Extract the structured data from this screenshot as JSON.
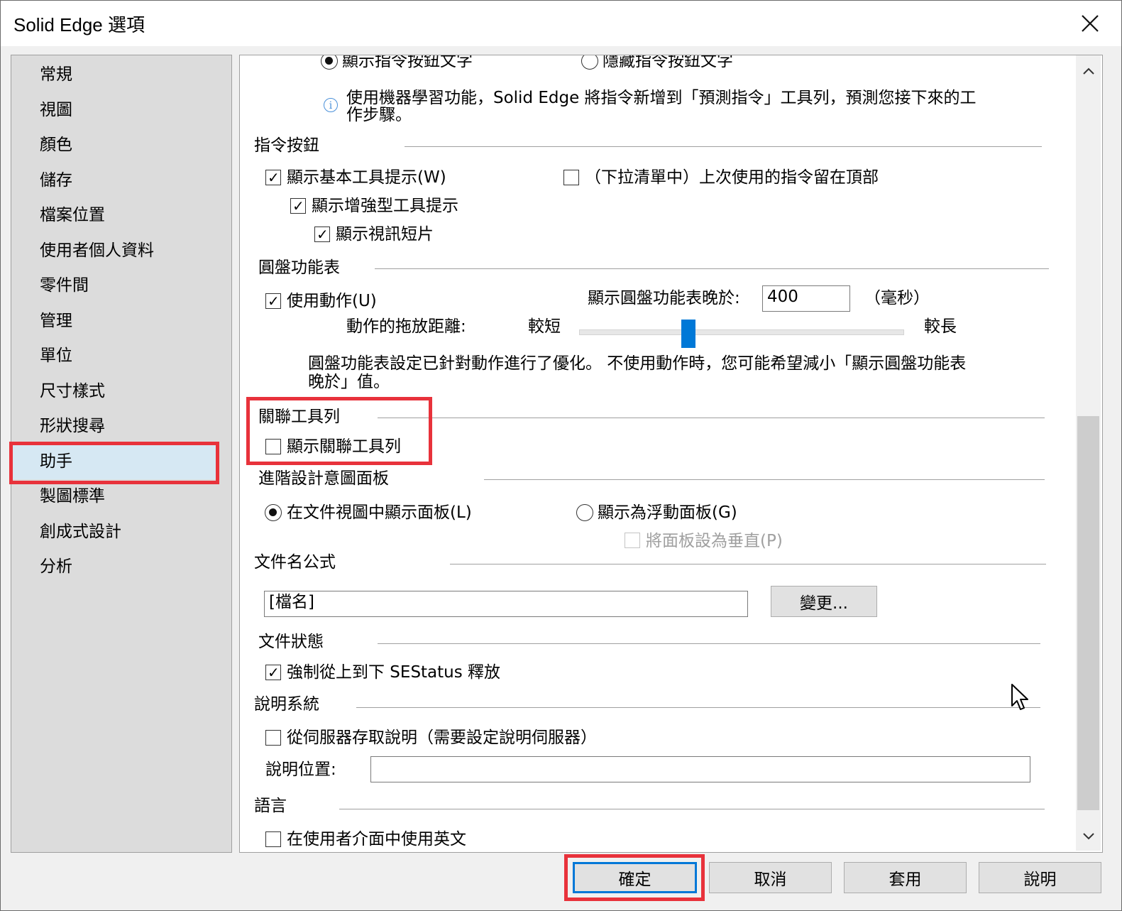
{
  "window": {
    "title": "Solid Edge 選項"
  },
  "nav": {
    "items": [
      "常規",
      "視圖",
      "顏色",
      "儲存",
      "檔案位置",
      "使用者個人資料",
      "零件間",
      "管理",
      "單位",
      "尺寸樣式",
      "形狀搜尋",
      "助手",
      "製圖標準",
      "創成式設計",
      "分析"
    ],
    "selected": "助手"
  },
  "top": {
    "show_text_radio": "顯示指令按鈕文字",
    "hide_text_radio": "隱藏指令按鈕文字",
    "info_line1": "使用機器學習功能，Solid Edge 將指令新增到「預測指令」工具列，預測您接下來的工",
    "info_line2": "作步驟。"
  },
  "command_buttons": {
    "header": "指令按鈕",
    "show_basic_tooltips": "顯示基本工具提示(W)",
    "keep_last_used_top": "（下拉清單中）上次使用的指令留在頂部",
    "show_enhanced_tooltips": "顯示增強型工具提示",
    "show_video_clips": "顯示視訊短片"
  },
  "radial_menu": {
    "header": "圓盤功能表",
    "use_gestures": "使用動作(U)",
    "delay_label": "顯示圓盤功能表晚於:",
    "delay_value": "400",
    "delay_unit": "（毫秒）",
    "drag_distance_label": "動作的拖放距離:",
    "short_label": "較短",
    "long_label": "較長",
    "drag_distance_fraction": 0.33,
    "note_line1": "圓盤功能表設定已針對動作進行了優化。 不使用動作時，您可能希望減小「顯示圓盤功能表",
    "note_line2": "晚於」值。"
  },
  "context_toolbar": {
    "header": "關聯工具列",
    "show_context_toolbar": "顯示關聯工具列"
  },
  "design_intent": {
    "header": "進階設計意圖面板",
    "show_in_doc_view": "在文件視圖中顯示面板(L)",
    "show_floating": "顯示為浮動面板(G)",
    "vertical_panel": "將面板設為垂直(P)"
  },
  "doc_name_formula": {
    "header": "文件名公式",
    "value": "[檔名]",
    "change_button": "變更..."
  },
  "doc_status": {
    "header": "文件狀態",
    "force_top_down": "強制從上到下 SEStatus 釋放"
  },
  "help_system": {
    "header": "說明系統",
    "access_from_server": "從伺服器存取說明（需要設定說明伺服器）",
    "location_label": "說明位置:",
    "location_value": ""
  },
  "language": {
    "header": "語言",
    "use_english": "在使用者介面中使用英文"
  },
  "footer": {
    "ok": "確定",
    "cancel": "取消",
    "apply": "套用",
    "help": "說明"
  },
  "colors": {
    "highlight": "#e8323b",
    "selection": "#d6e8f3",
    "slider_thumb": "#0078d7"
  }
}
